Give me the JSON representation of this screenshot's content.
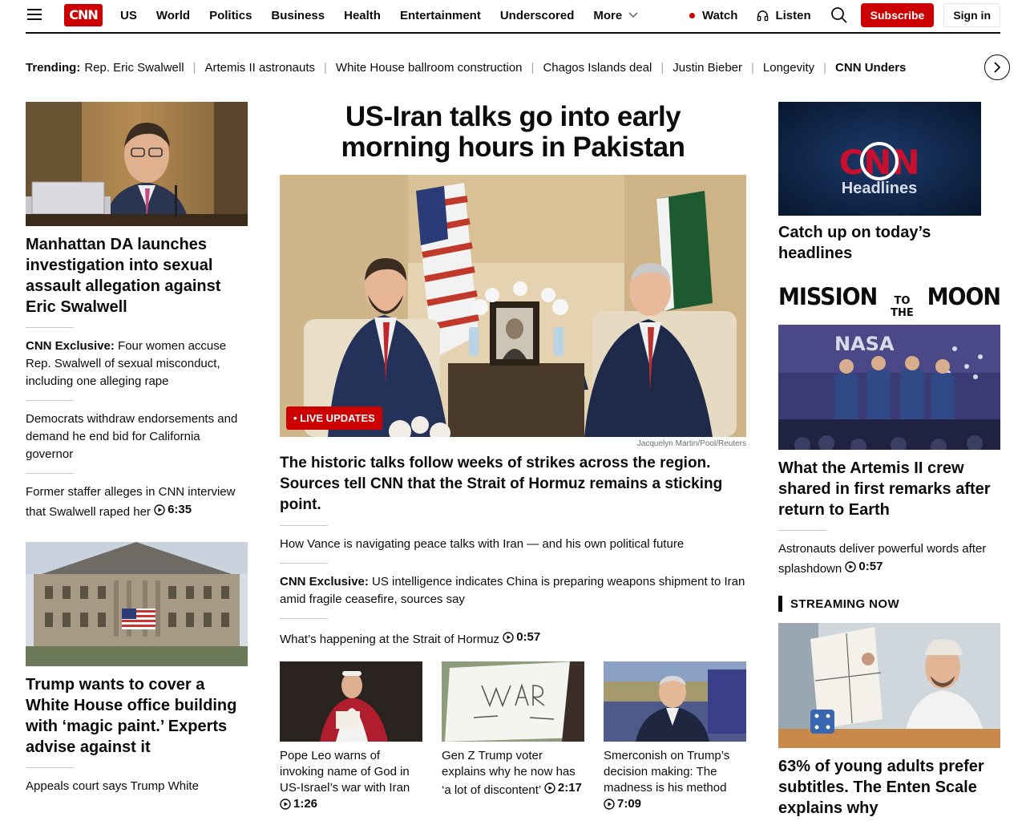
{
  "header": {
    "logo": "CNN",
    "nav": [
      "US",
      "World",
      "Politics",
      "Business",
      "Health",
      "Entertainment",
      "Underscored",
      "More"
    ],
    "watch": "Watch",
    "listen": "Listen",
    "subscribe": "Subscribe",
    "signin": "Sign in"
  },
  "trending": {
    "label": "Trending:",
    "items": [
      "Rep. Eric Swalwell",
      "Artemis II astronauts",
      "White House ballroom construction",
      "Chagos Islands deal",
      "Justin Bieber",
      "Longevity",
      "CNN Unders"
    ]
  },
  "left": {
    "story1": {
      "headline": "Manhattan DA launches investigation into sexual assault allegation against Eric Swalwell"
    },
    "item1": {
      "label": "CNN Exclusive:",
      "text": " Four women accuse Rep. Swalwell of sexual misconduct, including one alleging rape"
    },
    "item2": {
      "text": "Democrats withdraw endorsements and demand he end bid for California governor"
    },
    "item3": {
      "text": "Former staffer alleges in CNN interview that Swalwell raped her ",
      "duration": "6:35"
    },
    "story2": {
      "headline": "Trump wants to cover a White House office building with ‘magic paint.’ Experts advise against it"
    },
    "item4": {
      "text": "Appeals court says Trump White"
    }
  },
  "center": {
    "headline": "US-Iran talks go into early morning hours in Pakistan",
    "live": "LIVE UPDATES",
    "credit": "Jacquelyn Martin/Pool/Reuters",
    "subhead": "The historic talks follow weeks of strikes across the region. Sources tell CNN that the Strait of Hormuz remains a sticking point.",
    "item1": {
      "text": "How Vance is navigating peace talks with Iran — and his own political future"
    },
    "item2": {
      "label": "CNN Exclusive:",
      "text": " US intelligence indicates China is preparing weapons shipment to Iran amid fragile ceasefire, sources say"
    },
    "item3": {
      "text": "What’s happening at the Strait of Hormuz ",
      "duration": "0:57"
    },
    "thumbs": [
      {
        "caption": "Pope Leo warns of invoking name of God in US-Israel’s war with Iran ",
        "duration": "1:26"
      },
      {
        "caption": "Gen Z Trump voter explains why he now has ‘a lot of discontent’ ",
        "duration": "2:17"
      },
      {
        "caption": "Smerconish on Trump’s decision making: The madness is his method ",
        "duration": "7:09"
      }
    ]
  },
  "right": {
    "headlines_tile": {
      "logo": "CNN",
      "label": "Headlines"
    },
    "headlines_caption": "Catch up on today’s headlines",
    "mission": {
      "part1": "MISSION",
      "part2": "TO THE",
      "part3": "MOON"
    },
    "story1": {
      "headline": "What the Artemis II crew shared in first remarks after return to Earth"
    },
    "item1": {
      "text": "Astronauts deliver powerful words after splashdown ",
      "duration": "0:57"
    },
    "streaming_label": "STREAMING NOW",
    "story2": {
      "headline": "63% of young adults prefer subtitles. The Enten Scale explains why"
    }
  },
  "colors": {
    "brand": "#cc0000",
    "text": "#0c0c0c",
    "muted": "#6e6e6e"
  }
}
